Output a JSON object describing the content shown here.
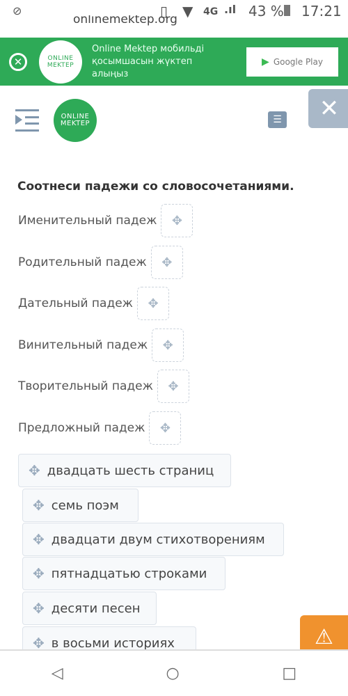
{
  "status_bar": {
    "left_icon": "do-not-disturb-icon",
    "network": "4G",
    "battery": "43 %",
    "time": "17:21"
  },
  "browser": {
    "url": "onlinemektep.org"
  },
  "banner": {
    "logo_line1": "ONLINE",
    "logo_line2": "MEKTEP",
    "text": "Online Mektep мобильді қосымшасын жүктеп алыңыз",
    "store_label": "Google Play"
  },
  "header": {
    "logo_line1": "ONLINE",
    "logo_line2": "MEKTEP"
  },
  "task": {
    "title": "Соотнеси падежи со словосочетаниями.",
    "cases": [
      "Именительный падеж",
      "Родительный падеж",
      "Дательный падеж",
      "Винительный падеж",
      "Творительный падеж",
      "Предложный падеж"
    ],
    "options": [
      "двадцать шесть страниц",
      "семь поэм",
      "двадцати двум стихотворениям",
      "пятнадцатью строками",
      "десяти песен",
      "в восьми историях"
    ]
  },
  "colors": {
    "brand_green": "#2eaa57",
    "close_grey": "#a9b8c8",
    "warning_orange": "#f0922e"
  }
}
